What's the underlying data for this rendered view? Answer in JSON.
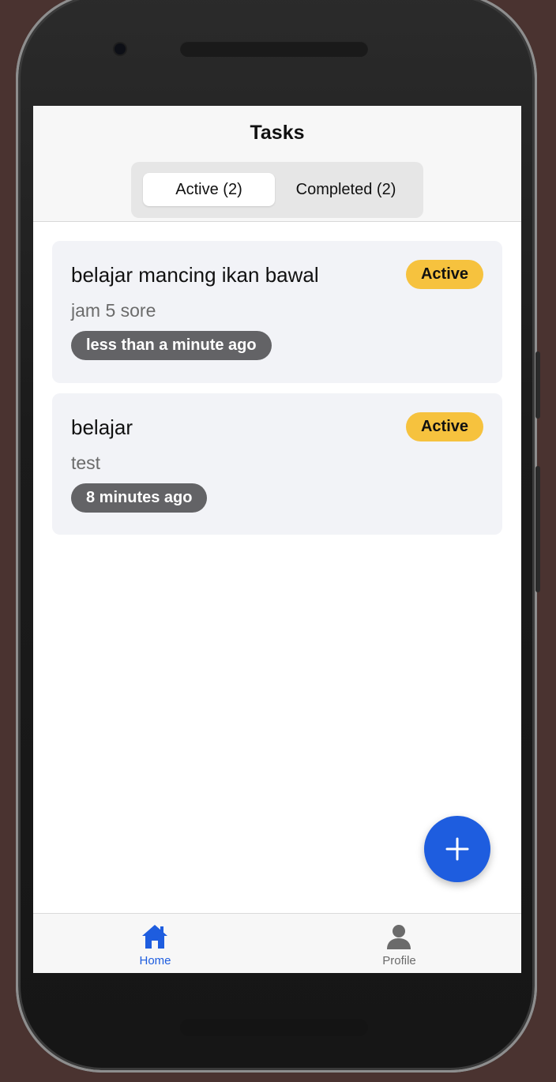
{
  "header": {
    "title": "Tasks",
    "segments": [
      {
        "label": "Active (2)",
        "selected": true
      },
      {
        "label": "Completed (2)",
        "selected": false
      }
    ]
  },
  "tasks": [
    {
      "title": "belajar mancing ikan bawal",
      "description": "jam 5 sore",
      "status": "Active",
      "time": "less than a minute ago"
    },
    {
      "title": "belajar",
      "description": "test",
      "status": "Active",
      "time": "8 minutes ago"
    }
  ],
  "fab": {
    "icon": "plus-icon"
  },
  "tabbar": {
    "items": [
      {
        "label": "Home",
        "icon": "home-icon",
        "selected": true
      },
      {
        "label": "Profile",
        "icon": "user-icon",
        "selected": false
      }
    ]
  },
  "colors": {
    "accent": "#1e5ddf",
    "status_active": "#f6c23e",
    "time_pill": "#636366",
    "tab_inactive": "#6b6b6b"
  }
}
